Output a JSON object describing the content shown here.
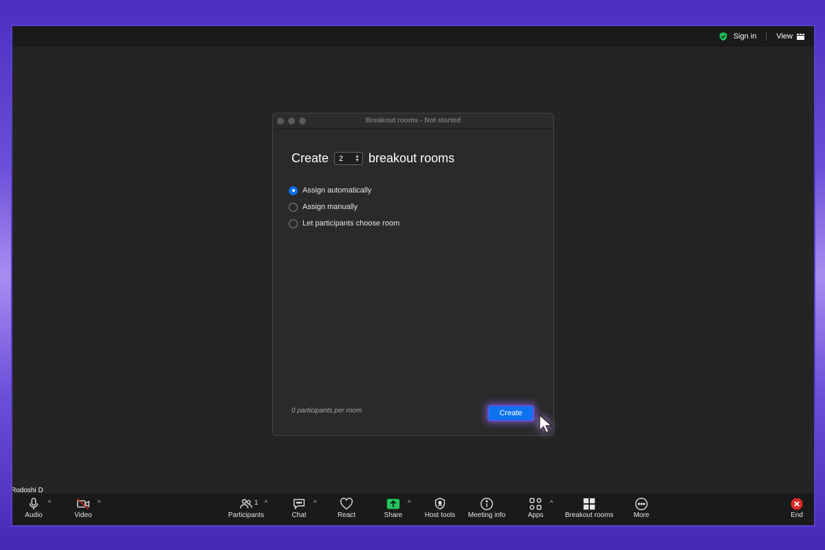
{
  "topbar": {
    "sign_in": "Sign in",
    "view": "View"
  },
  "user": {
    "name": "Rodoshi D"
  },
  "dialog": {
    "title": "Breakout rooms - Not started",
    "create_prefix": "Create",
    "room_count": "2",
    "create_suffix": "breakout rooms",
    "options": [
      {
        "label": "Assign automatically",
        "selected": true
      },
      {
        "label": "Assign manually",
        "selected": false
      },
      {
        "label": "Let participants choose room",
        "selected": false
      }
    ],
    "per_room": "0 participants per room",
    "create_button": "Create"
  },
  "toolbar": {
    "audio": "Audio",
    "video": "Video",
    "participants": "Participants",
    "participant_count": "1",
    "chat": "Chat",
    "react": "React",
    "share": "Share",
    "host_tools": "Host tools",
    "meeting_info": "Meeting info",
    "apps": "Apps",
    "breakout_rooms": "Breakout rooms",
    "more": "More",
    "end": "End"
  },
  "colors": {
    "accent": "#0e72ed",
    "share_green": "#22c55e",
    "end_red": "#e02828",
    "shield_green": "#1fbf5a"
  }
}
